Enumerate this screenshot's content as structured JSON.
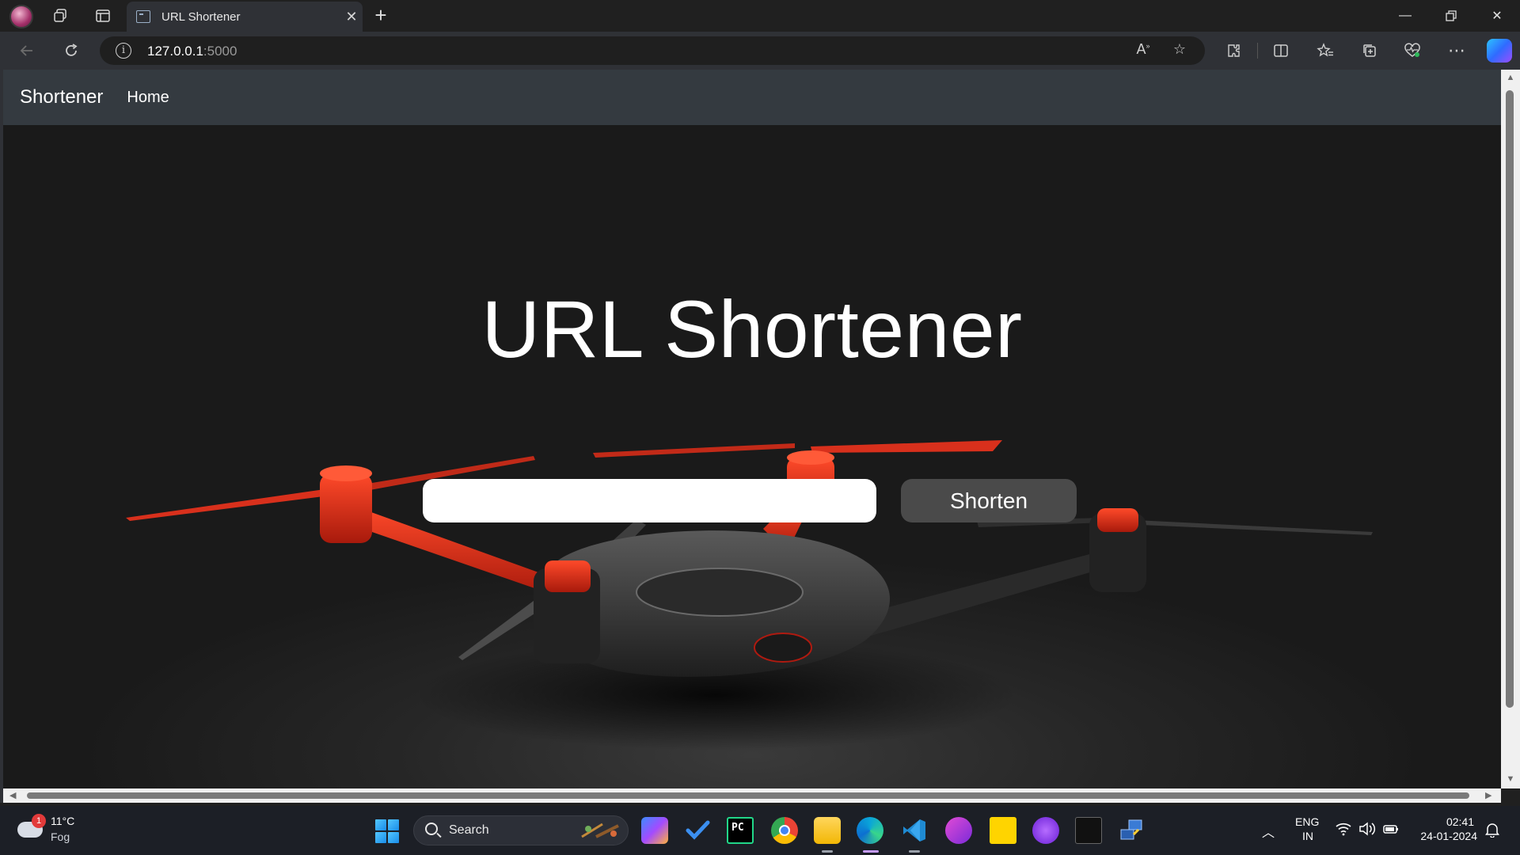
{
  "browser": {
    "tab_title": "URL Shortener",
    "address_host": "127.0.0.1",
    "address_port": ":5000"
  },
  "page": {
    "navbar": {
      "brand": "Shortener",
      "home_link": "Home"
    },
    "headline": "URL Shortener",
    "url_input": {
      "value": "",
      "placeholder": ""
    },
    "shorten_button": "Shorten",
    "colors": {
      "navbar_bg": "#343a40",
      "button_bg": "#4a4a4a",
      "drone_accent": "#e0301e"
    }
  },
  "taskbar": {
    "weather": {
      "badge": "1",
      "temperature": "11°C",
      "condition": "Fog"
    },
    "search_label": "Search",
    "apps": [
      "copilot-pre-icon",
      "todo-icon",
      "pycharm-icon",
      "chrome-icon",
      "file-explorer-icon",
      "edge-icon",
      "vscode-icon",
      "game-icon",
      "sticky-notes-icon",
      "app-icon",
      "terminal-icon",
      "remote-icon"
    ],
    "language": {
      "line1": "ENG",
      "line2": "IN"
    },
    "clock": {
      "time": "02:41",
      "date": "24-01-2024"
    }
  }
}
